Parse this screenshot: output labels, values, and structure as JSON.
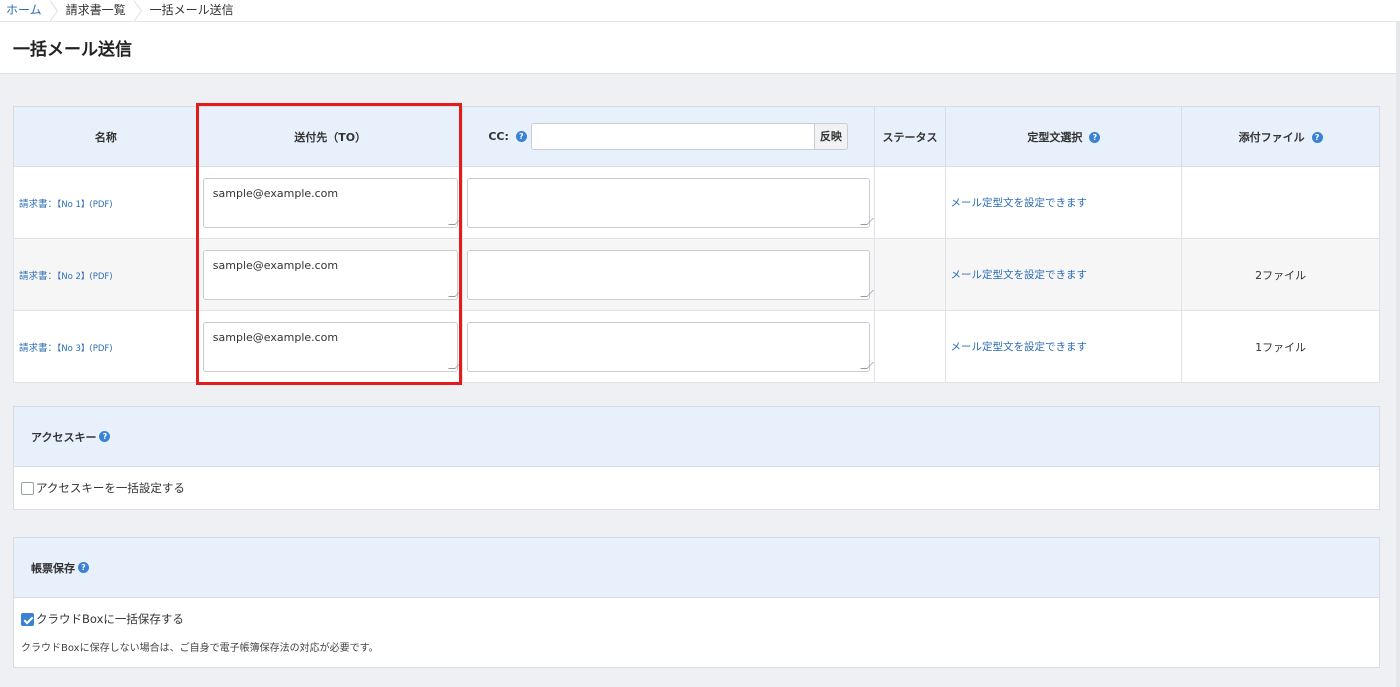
{
  "breadcrumb": {
    "home": "ホーム",
    "list": "請求書一覧",
    "current": "一括メール送信"
  },
  "page_title": "一括メール送信",
  "table": {
    "headers": {
      "name": "名称",
      "to": "送付先（TO）",
      "cc": "CC:",
      "cc_apply": "反映",
      "status": "ステータス",
      "template": "定型文選択",
      "files": "添付ファイル"
    },
    "rows": [
      {
        "name": "請求書：",
        "number": "【No 1】(PDF)",
        "to": "sample@example.com",
        "cc": "",
        "status": "",
        "template": "メール定型文を設定できます",
        "files": ""
      },
      {
        "name": "請求書：",
        "number": "【No 2】(PDF)",
        "to": "sample@example.com",
        "cc": "",
        "status": "",
        "template": "メール定型文を設定できます",
        "files": "2ファイル"
      },
      {
        "name": "請求書：",
        "number": "【No 3】(PDF)",
        "to": "sample@example.com",
        "cc": "",
        "status": "",
        "template": "メール定型文を設定できます",
        "files": "1ファイル"
      }
    ]
  },
  "access_key": {
    "title": "アクセスキー",
    "checkbox_label": "アクセスキーを一括設定する",
    "checked": false
  },
  "doc_save": {
    "title": "帳票保存",
    "checkbox_label": "クラウドBoxに一括保存する",
    "checked": true,
    "note": "クラウドBoxに保存しない場合は、ご自身で電子帳簿保存法の対応が必要です。"
  },
  "colors": {
    "accent": "#3b82d4",
    "link": "#2d6db4",
    "header_bg": "#e8f0fb",
    "highlight": "#e21b1b"
  },
  "icons": {
    "help": "help-circle-icon",
    "check": "checkmark-icon"
  }
}
